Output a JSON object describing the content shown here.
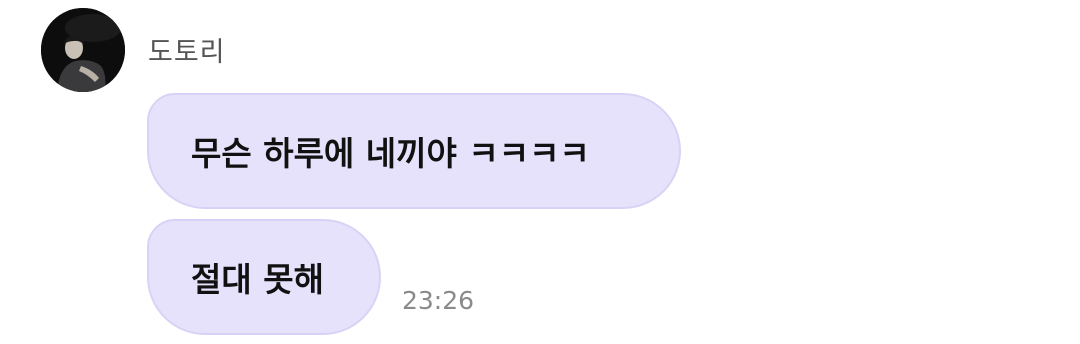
{
  "chat": {
    "sender_name": "도토리",
    "avatar_icon": "profile-photo",
    "messages": [
      {
        "text": "무슨 하루에 네끼야 ㅋㅋㅋㅋ"
      },
      {
        "text": "절대 못해"
      }
    ],
    "timestamp": "23:26"
  },
  "colors": {
    "bubble_background": "#e6e2fb",
    "bubble_border": "#d8d3f6",
    "sender_text": "#555555",
    "timestamp_text": "#8a8a8a"
  }
}
